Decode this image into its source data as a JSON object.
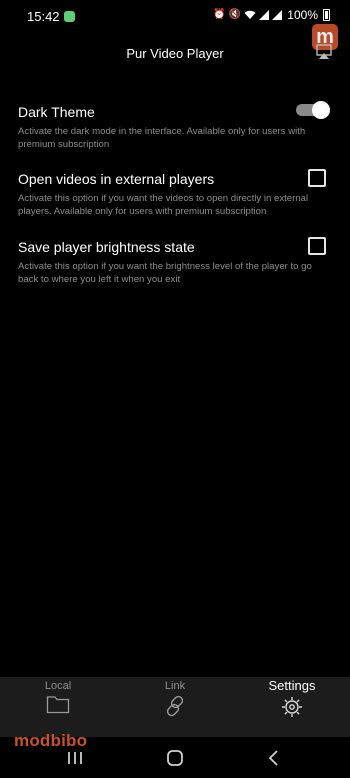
{
  "status_bar": {
    "time": "15:42",
    "battery": "100%"
  },
  "header": {
    "title": "Pur Video Player",
    "cast_icon": "cast-icon"
  },
  "watermark": {
    "logo_letter": "m",
    "text": "modbibo",
    "color": "#c9512c"
  },
  "settings": [
    {
      "title": "Dark Theme",
      "description": "Activate the dark mode in the interface. Available only for users with premium subscription",
      "control": "toggle",
      "enabled": true
    },
    {
      "title": "Open videos in external players",
      "description": "Activate this option if you want the videos to open directly in external players. Available only for users with premium subscription",
      "control": "checkbox",
      "enabled": false
    },
    {
      "title": "Save player brightness state",
      "description": "Activate this option if you want the brightness level of the player to go back to where you left it when you exit",
      "control": "checkbox",
      "enabled": false
    }
  ],
  "bottom_nav": {
    "tabs": [
      {
        "label": "Local",
        "icon": "folder-icon",
        "active": false
      },
      {
        "label": "Link",
        "icon": "link-icon",
        "active": false
      },
      {
        "label": "Settings",
        "icon": "gear-icon",
        "active": true
      }
    ]
  },
  "system_nav": {
    "icons": [
      "recent-apps-icon",
      "home-icon",
      "back-icon"
    ]
  }
}
